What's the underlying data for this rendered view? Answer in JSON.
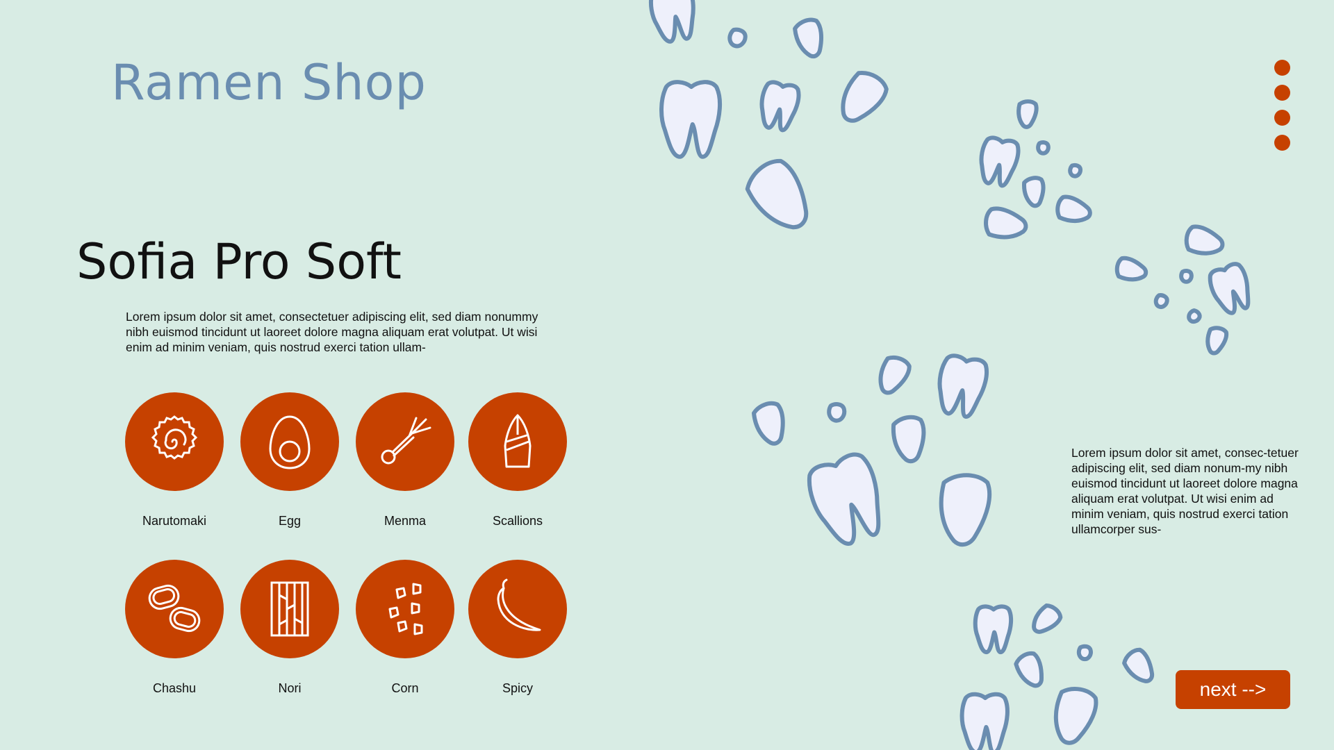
{
  "brand": {
    "title": "Ramen Shop"
  },
  "headline": "Sofia Pro Soft",
  "intro": "Lorem ipsum dolor sit amet, consectetuer adipiscing elit, sed diam nonummy nibh euismod tincidunt ut laoreet dolore magna aliquam erat volutpat. Ut wisi enim ad minim veniam, quis nostrud exerci tation ullam-",
  "side_text": "Lorem ipsum dolor sit amet, consec-tetuer adipiscing elit, sed diam nonum-my nibh euismod tincidunt ut laoreet dolore magna aliquam erat volutpat. Ut wisi enim ad minim veniam, quis nostrud exerci tation ullamcorper sus-",
  "ingredients": [
    {
      "label": "Narutomaki",
      "icon": "narutomaki-icon"
    },
    {
      "label": "Egg",
      "icon": "egg-icon"
    },
    {
      "label": "Menma",
      "icon": "menma-icon"
    },
    {
      "label": "Scallions",
      "icon": "scallions-icon"
    },
    {
      "label": "Chashu",
      "icon": "chashu-icon"
    },
    {
      "label": "Nori",
      "icon": "nori-icon"
    },
    {
      "label": "Corn",
      "icon": "corn-icon"
    },
    {
      "label": "Spicy",
      "icon": "spicy-icon"
    }
  ],
  "pagination": {
    "pages": 4
  },
  "next_button": {
    "label": "next -->"
  },
  "colors": {
    "background": "#d8ece4",
    "accent": "#c64100",
    "brand": "#6a8db0",
    "tooth_fill": "#eef0fb",
    "tooth_stroke": "#6a8db0"
  }
}
